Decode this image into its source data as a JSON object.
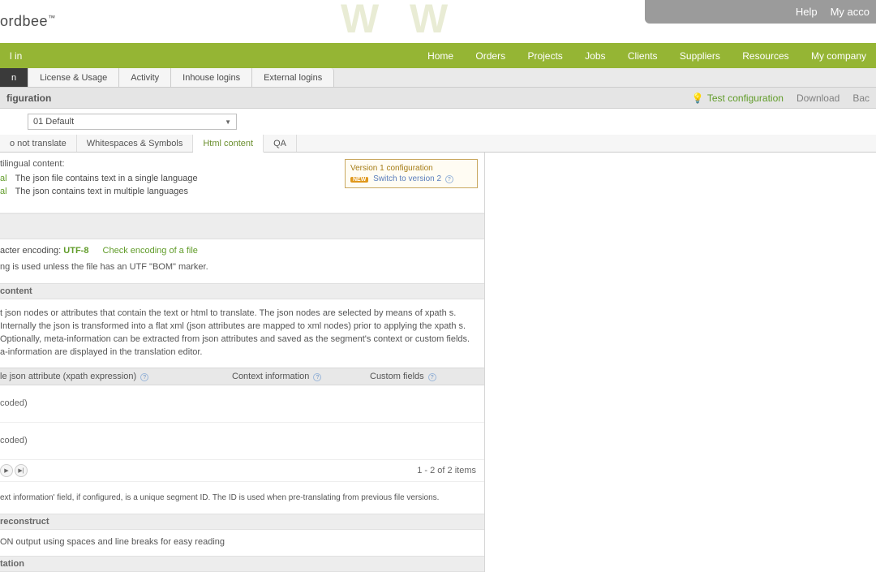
{
  "top": {
    "help": "Help",
    "account": "My acco"
  },
  "logo": "ordbee",
  "nav": {
    "left_partial": "l in",
    "items": [
      "Home",
      "Orders",
      "Projects",
      "Jobs",
      "Clients",
      "Suppliers",
      "Resources",
      "My company"
    ]
  },
  "tabs": {
    "active_partial": "n",
    "items": [
      "License & Usage",
      "Activity",
      "Inhouse logins",
      "External logins"
    ]
  },
  "title_bar": {
    "left": "figuration",
    "test": "Test configuration",
    "download": "Download",
    "back": "Bac"
  },
  "dropdown": {
    "selected": "01 Default"
  },
  "subtabs": {
    "items": [
      "o not translate",
      "Whitespaces & Symbols",
      "Html content",
      "QA"
    ]
  },
  "multilingual": {
    "label": "tilingual content:",
    "opt1_tag": "al",
    "opt1_text": "The json file contains text in a single language",
    "opt2_tag": "al",
    "opt2_text": "The json contains text in multiple languages"
  },
  "version_box": {
    "title": "Version 1 configuration",
    "new": "NEW",
    "switch": "Switch to version 2"
  },
  "encoding": {
    "label": "acter encoding:",
    "value": "UTF-8",
    "check": "Check encoding of a file",
    "desc": "ng is used unless the file has an UTF \"BOM\" marker."
  },
  "content_section": {
    "header": "content",
    "body": "t json nodes or attributes that contain the text or html to translate. The json nodes are selected by means of xpath s. Internally the json is transformed into a flat xml (json attributes are mapped to xml nodes) prior to applying the xpath s. Optionally, meta-information can be extracted from json attributes and saved as the segment's context or custom fields. a-information are displayed in the translation editor."
  },
  "table": {
    "col1": "le json attribute (xpath expression)",
    "col2": "Context information",
    "col3": "Custom fields",
    "rows": [
      {
        "c1": "coded)"
      },
      {
        "c1": "coded)"
      }
    ],
    "pager_text": "1 - 2 of 2 items"
  },
  "note": "ext information' field, if configured, is a unique segment ID. The ID is used when pre-translating from previous file versions.",
  "reconstruct": {
    "header": "reconstruct",
    "body": "ON output using spaces and line breaks for easy reading"
  },
  "tation": {
    "header": "tation"
  }
}
